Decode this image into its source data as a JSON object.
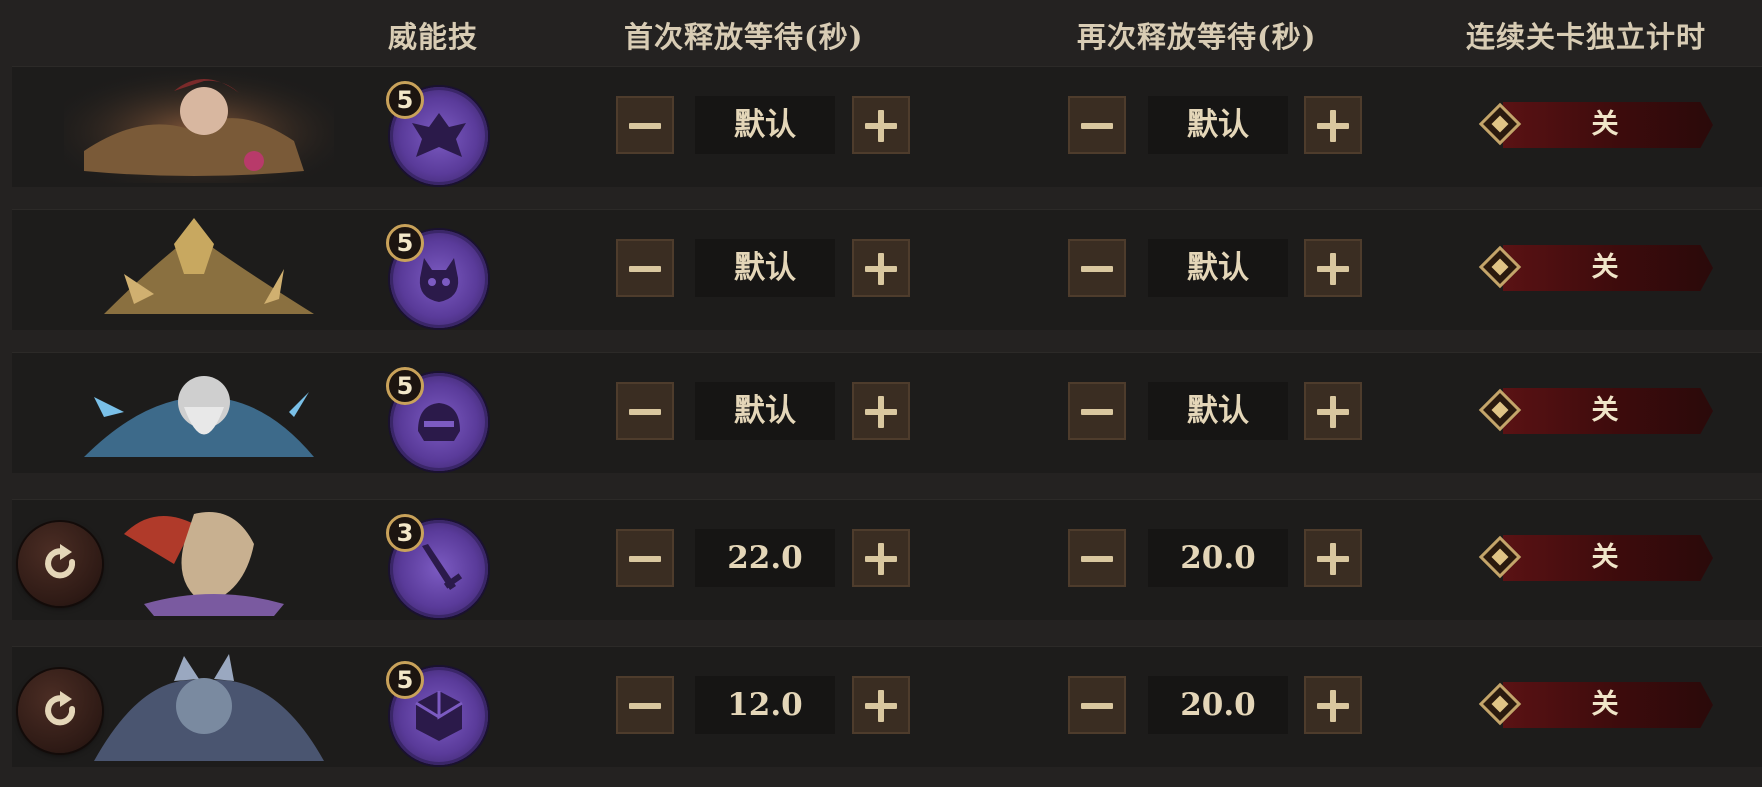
{
  "header": {
    "col_skill": "威能技",
    "col_first": "首次释放等待(秒)",
    "col_repeat": "再次释放等待(秒)",
    "col_timer": "连续关卡独立计时"
  },
  "rows": [
    {
      "boss": "boss-1-portrait",
      "has_reset": false,
      "skill_level": "5",
      "skill_icon": "bat-spirit-icon",
      "first_wait": "默认",
      "repeat_wait": "默认",
      "timer": "关"
    },
    {
      "boss": "boss-2-portrait",
      "has_reset": false,
      "skill_level": "5",
      "skill_icon": "demon-skull-icon",
      "first_wait": "默认",
      "repeat_wait": "默认",
      "timer": "关"
    },
    {
      "boss": "boss-3-portrait",
      "has_reset": false,
      "skill_level": "5",
      "skill_icon": "helmet-icon",
      "first_wait": "默认",
      "repeat_wait": "默认",
      "timer": "关"
    },
    {
      "boss": "boss-4-portrait",
      "has_reset": true,
      "skill_level": "3",
      "skill_icon": "sword-icon",
      "first_wait": "22.0",
      "repeat_wait": "20.0",
      "timer": "关"
    },
    {
      "boss": "boss-5-portrait",
      "has_reset": true,
      "skill_level": "5",
      "skill_icon": "cube-icon",
      "first_wait": "12.0",
      "repeat_wait": "20.0",
      "timer": "关"
    }
  ],
  "colors": {
    "background": "#242221",
    "row": "#1d1c1b",
    "skill": "#6a4ab0",
    "toggle": "#4a0f10",
    "accent": "#c9a25a"
  }
}
